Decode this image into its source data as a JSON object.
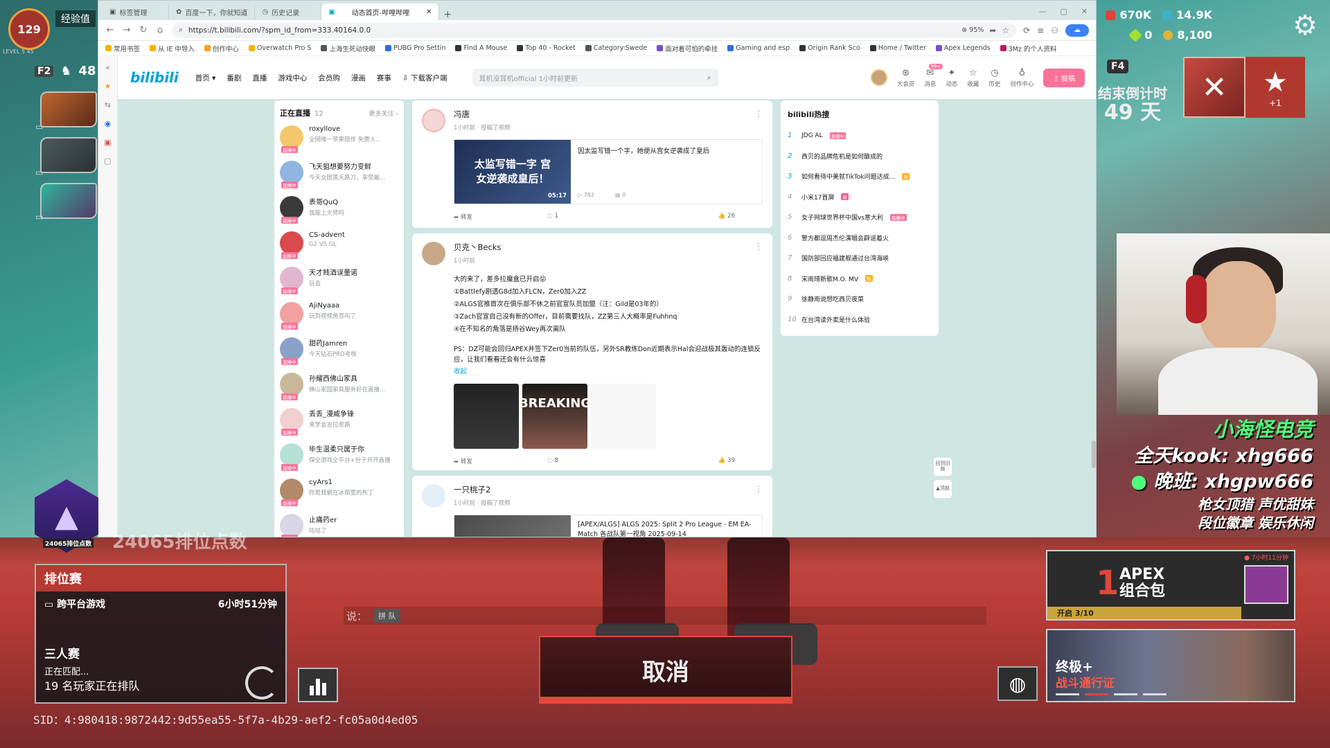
{
  "browser": {
    "tabs": [
      "标签管理",
      "百度一下，你就知道",
      "历史记录",
      "动态首页-哔哩哔哩"
    ],
    "url": "https://t.bilibili.com/?spm_id_from=333.40164.0.0",
    "zoom": "95%",
    "bookmarks": [
      "常用书签",
      "从 IE 中导入",
      "创作中心",
      "Overwatch Pro S",
      "上海生死动快眼",
      "PUBG Pro Settin",
      "Find A Mouse",
      "Top 40 - Rocket",
      "Category:Swede",
      "面对着可怕的牵挂",
      "Gaming and esp",
      "Origin Rank Sco",
      "Home / Twitter",
      "Apex Legends",
      "3Mz 的个人资料"
    ]
  },
  "bili": {
    "nav": [
      "首页",
      "番剧",
      "直播",
      "游戏中心",
      "会员购",
      "漫画",
      "赛事",
      "下载客户端"
    ],
    "search_placeholder": "耳机没耳机official 1小时前更新",
    "header_icons": [
      "大会员",
      "消息",
      "动态",
      "收藏",
      "历史",
      "创作中心"
    ],
    "msg_badge": "99+",
    "upload": "投稿"
  },
  "live": {
    "title": "正在直播",
    "count": "12",
    "more": "更多关注",
    "badge": "直播中",
    "items": [
      {
        "name": "roxyllove",
        "desc": "全网唯一苹果陪伴 免费人..."
      },
      {
        "name": "飞天狙想要努力变鲜",
        "desc": "今天女团黑天路刀，享受最..."
      },
      {
        "name": "表哥QuQ",
        "desc": "我能上大师吗"
      },
      {
        "name": "CS-advent",
        "desc": "G2 VS GL"
      },
      {
        "name": "天才贱酒误量诺",
        "desc": "玩会"
      },
      {
        "name": "AjiNyaaa",
        "desc": "玩到视频角恩叫了"
      },
      {
        "name": "甜药Jamren",
        "desc": "今天钻石PRO考核"
      },
      {
        "name": "孙耀西佛山家具",
        "desc": "佛山家园家具服务好在直播..."
      },
      {
        "name": "丢丢_漫威争锋",
        "desc": "来学会吉拉思路"
      },
      {
        "name": "毕生温柔只属于你",
        "desc": "保全游戏全平台+份子开开直播"
      },
      {
        "name": "cyArs1",
        "desc": "你是我躺在冰凿里的布丁"
      },
      {
        "name": "止痛药er",
        "desc": "咕咕了"
      }
    ]
  },
  "feed": [
    {
      "name": "冯唐",
      "meta": "1小时前 · 投稿了视频",
      "thumb_text": "太监写错一字 宫女逆袭成皇后！",
      "duration": "05:17",
      "video_title": "因太监写错一个字，她便从宫女逆袭成了皇后",
      "plays": "782",
      "danmaku": "0",
      "forward": "转发",
      "comments": "1",
      "likes": "26"
    },
    {
      "name": "贝克丶Becks",
      "meta": "1小时前",
      "lines": [
        "大的来了，差多拉魔盒已开启😝",
        "①Battlefy剧透G8d加入FLCN，Zer0加入ZZ",
        "②ALGS官推首次在俱乐部不休之前官宣队员加盟（注：Gild是03年的）",
        "③Zach官宣自己没有新的Offer，目前需要找队，ZZ第三人大概率是Fuhhnq",
        "④在不知名的角落是扬谷Wey再次离队",
        "",
        "PS：DZ可能会回归APEX并签下Zer0当前的队伍，另外SR教练Don近期表示Hal会迎战极其轰动的连锁反应，让我们看看还会有什么惊喜"
      ],
      "fold": "收起",
      "breaking": "BREAKING",
      "forward": "转发",
      "comments": "8",
      "likes": "39"
    },
    {
      "name": "一只桃子2",
      "meta": "1小时前 · 投稿了视频",
      "video_title": "[APEX/ALGS] ALGS 2025: Split 2 Pro League - EM EA-Match 各战队第一视角 2025-09-14"
    }
  ],
  "hot": {
    "title": "bilibili热搜",
    "items": [
      {
        "rank": "1",
        "text": "JDG AL",
        "tag": "直播中"
      },
      {
        "rank": "2",
        "text": "西贝的品牌危机是如何酿成的",
        "tag": ""
      },
      {
        "rank": "3",
        "text": "如何看待中美就TikTok问题达成...",
        "tag": "热"
      },
      {
        "rank": "4",
        "text": "小米17首屏",
        "tag": "新"
      },
      {
        "rank": "5",
        "text": "女子网球世界杯中国vs意大利",
        "tag": "直播中"
      },
      {
        "rank": "6",
        "text": "警方都逗周杰伦演唱会辟谣着火",
        "tag": ""
      },
      {
        "rank": "7",
        "text": "国防部回应福建舰通过台湾海峡",
        "tag": ""
      },
      {
        "rank": "8",
        "text": "宋雨琦新歌M.O. MV",
        "tag": "热"
      },
      {
        "rank": "9",
        "text": "徐静雨说想吃西贝夜菜",
        "tag": ""
      },
      {
        "rank": "10",
        "text": "在台湾读外卖是什么体验",
        "tag": ""
      }
    ],
    "side_buttons": [
      "回到旧版",
      "顶部"
    ]
  },
  "game": {
    "level": "129",
    "xp_label": "经验值",
    "level_sub": "LEVEL 5 45",
    "f2": "F2",
    "party_count": "48",
    "f4": "F4",
    "currency": {
      "c1": "670K",
      "c2": "14.9K",
      "c3": "0",
      "c4": "8,100"
    },
    "countdown_label": "结束倒计时",
    "countdown_value": "49 天",
    "star_plus": "+1",
    "promo": [
      "小海怪电竞",
      "全天kook: xhg666",
      "晚班: xhgpw666",
      "枪女顶猎 声优甜妹",
      "段位徽章 娱乐休闲"
    ],
    "rank_points": "24065排位点数",
    "rank_points_small": "24065排位点数",
    "ranked_title": "排位赛",
    "crossplay": "跨平台游戏",
    "queue_time": "6小时51分钟",
    "mode": "三人赛",
    "matching": "正在匹配...",
    "players_queued": "19 名玩家正在排队",
    "sid": "SID：4:980418:9872442:9d55ea55-5f7a-4b29-aef2-fc05a0d4ed05",
    "chat_say": "说：",
    "chat_channel": "拼 队",
    "cancel": "取消",
    "pack_count": "1",
    "pack_name_1": "APEX",
    "pack_name_2": "组合包",
    "pack_open": "开启 3/10",
    "pack_timer": "7小时11分钟",
    "pass_1": "终极+",
    "pass_2": "战斗通行证"
  }
}
